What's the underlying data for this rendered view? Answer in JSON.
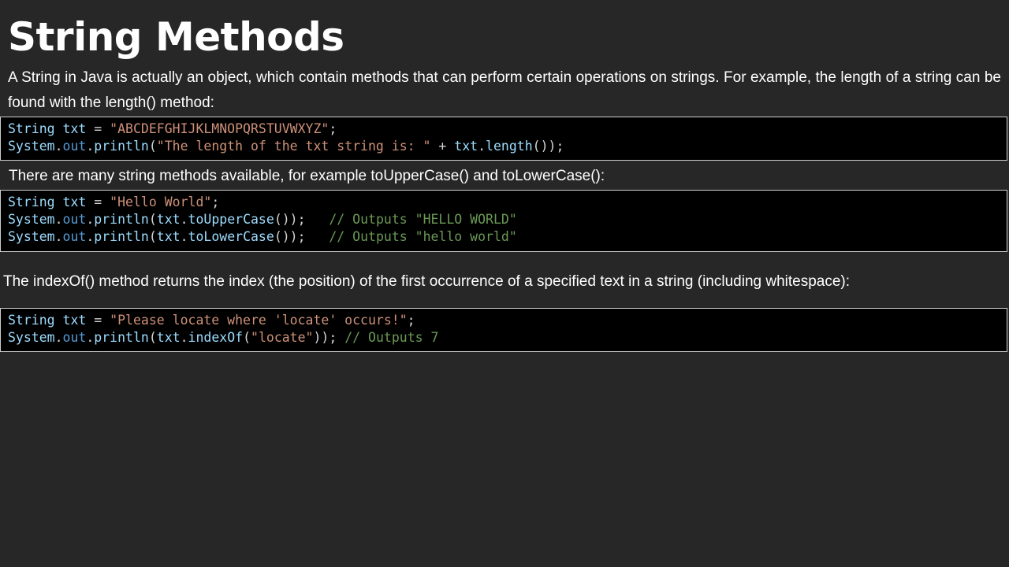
{
  "title": "String Methods",
  "intro": "A String in Java is actually an object, which contain methods that can perform certain operations on strings. For example, the length of a string can be found with the length() method:",
  "methods_text": "There are many string methods available, for example toUpperCase() and toLowerCase():",
  "indexof_text": "The indexOf() method returns the index (the position) of the first occurrence of a specified text in a string (including whitespace):",
  "code_blocks": [
    {
      "lines": [
        [
          {
            "t": "String",
            "c": "type"
          },
          {
            "t": " ",
            "c": "op"
          },
          {
            "t": "txt",
            "c": "var"
          },
          {
            "t": " = ",
            "c": "op"
          },
          {
            "t": "\"ABCDEFGHIJKLMNOPQRSTUVWXYZ\"",
            "c": "str"
          },
          {
            "t": ";",
            "c": "punc"
          }
        ],
        [
          {
            "t": "System",
            "c": "type"
          },
          {
            "t": ".",
            "c": "punc"
          },
          {
            "t": "out",
            "c": "field"
          },
          {
            "t": ".",
            "c": "punc"
          },
          {
            "t": "println",
            "c": "meth"
          },
          {
            "t": "(",
            "c": "punc"
          },
          {
            "t": "\"The length of the txt string is: \"",
            "c": "str"
          },
          {
            "t": " + ",
            "c": "op"
          },
          {
            "t": "txt",
            "c": "var"
          },
          {
            "t": ".",
            "c": "punc"
          },
          {
            "t": "length",
            "c": "meth"
          },
          {
            "t": "());",
            "c": "punc"
          }
        ]
      ]
    },
    {
      "lines": [
        [
          {
            "t": "String",
            "c": "type"
          },
          {
            "t": " ",
            "c": "op"
          },
          {
            "t": "txt",
            "c": "var"
          },
          {
            "t": " = ",
            "c": "op"
          },
          {
            "t": "\"Hello World\"",
            "c": "str"
          },
          {
            "t": ";",
            "c": "punc"
          }
        ],
        [
          {
            "t": "System",
            "c": "type"
          },
          {
            "t": ".",
            "c": "punc"
          },
          {
            "t": "out",
            "c": "field"
          },
          {
            "t": ".",
            "c": "punc"
          },
          {
            "t": "println",
            "c": "meth"
          },
          {
            "t": "(",
            "c": "punc"
          },
          {
            "t": "txt",
            "c": "var"
          },
          {
            "t": ".",
            "c": "punc"
          },
          {
            "t": "toUpperCase",
            "c": "meth"
          },
          {
            "t": "());   ",
            "c": "punc"
          },
          {
            "t": "// Outputs \"HELLO WORLD\"",
            "c": "com"
          }
        ],
        [
          {
            "t": "System",
            "c": "type"
          },
          {
            "t": ".",
            "c": "punc"
          },
          {
            "t": "out",
            "c": "field"
          },
          {
            "t": ".",
            "c": "punc"
          },
          {
            "t": "println",
            "c": "meth"
          },
          {
            "t": "(",
            "c": "punc"
          },
          {
            "t": "txt",
            "c": "var"
          },
          {
            "t": ".",
            "c": "punc"
          },
          {
            "t": "toLowerCase",
            "c": "meth"
          },
          {
            "t": "());   ",
            "c": "punc"
          },
          {
            "t": "// Outputs \"hello world\"",
            "c": "com"
          }
        ]
      ]
    },
    {
      "lines": [
        [
          {
            "t": "String",
            "c": "type"
          },
          {
            "t": " ",
            "c": "op"
          },
          {
            "t": "txt",
            "c": "var"
          },
          {
            "t": " = ",
            "c": "op"
          },
          {
            "t": "\"Please locate where 'locate' occurs!\"",
            "c": "str"
          },
          {
            "t": ";",
            "c": "punc"
          }
        ],
        [
          {
            "t": "System",
            "c": "type"
          },
          {
            "t": ".",
            "c": "punc"
          },
          {
            "t": "out",
            "c": "field"
          },
          {
            "t": ".",
            "c": "punc"
          },
          {
            "t": "println",
            "c": "meth"
          },
          {
            "t": "(",
            "c": "punc"
          },
          {
            "t": "txt",
            "c": "var"
          },
          {
            "t": ".",
            "c": "punc"
          },
          {
            "t": "indexOf",
            "c": "meth"
          },
          {
            "t": "(",
            "c": "punc"
          },
          {
            "t": "\"locate\"",
            "c": "str"
          },
          {
            "t": ")); ",
            "c": "punc"
          },
          {
            "t": "// Outputs 7",
            "c": "com"
          }
        ]
      ]
    }
  ]
}
